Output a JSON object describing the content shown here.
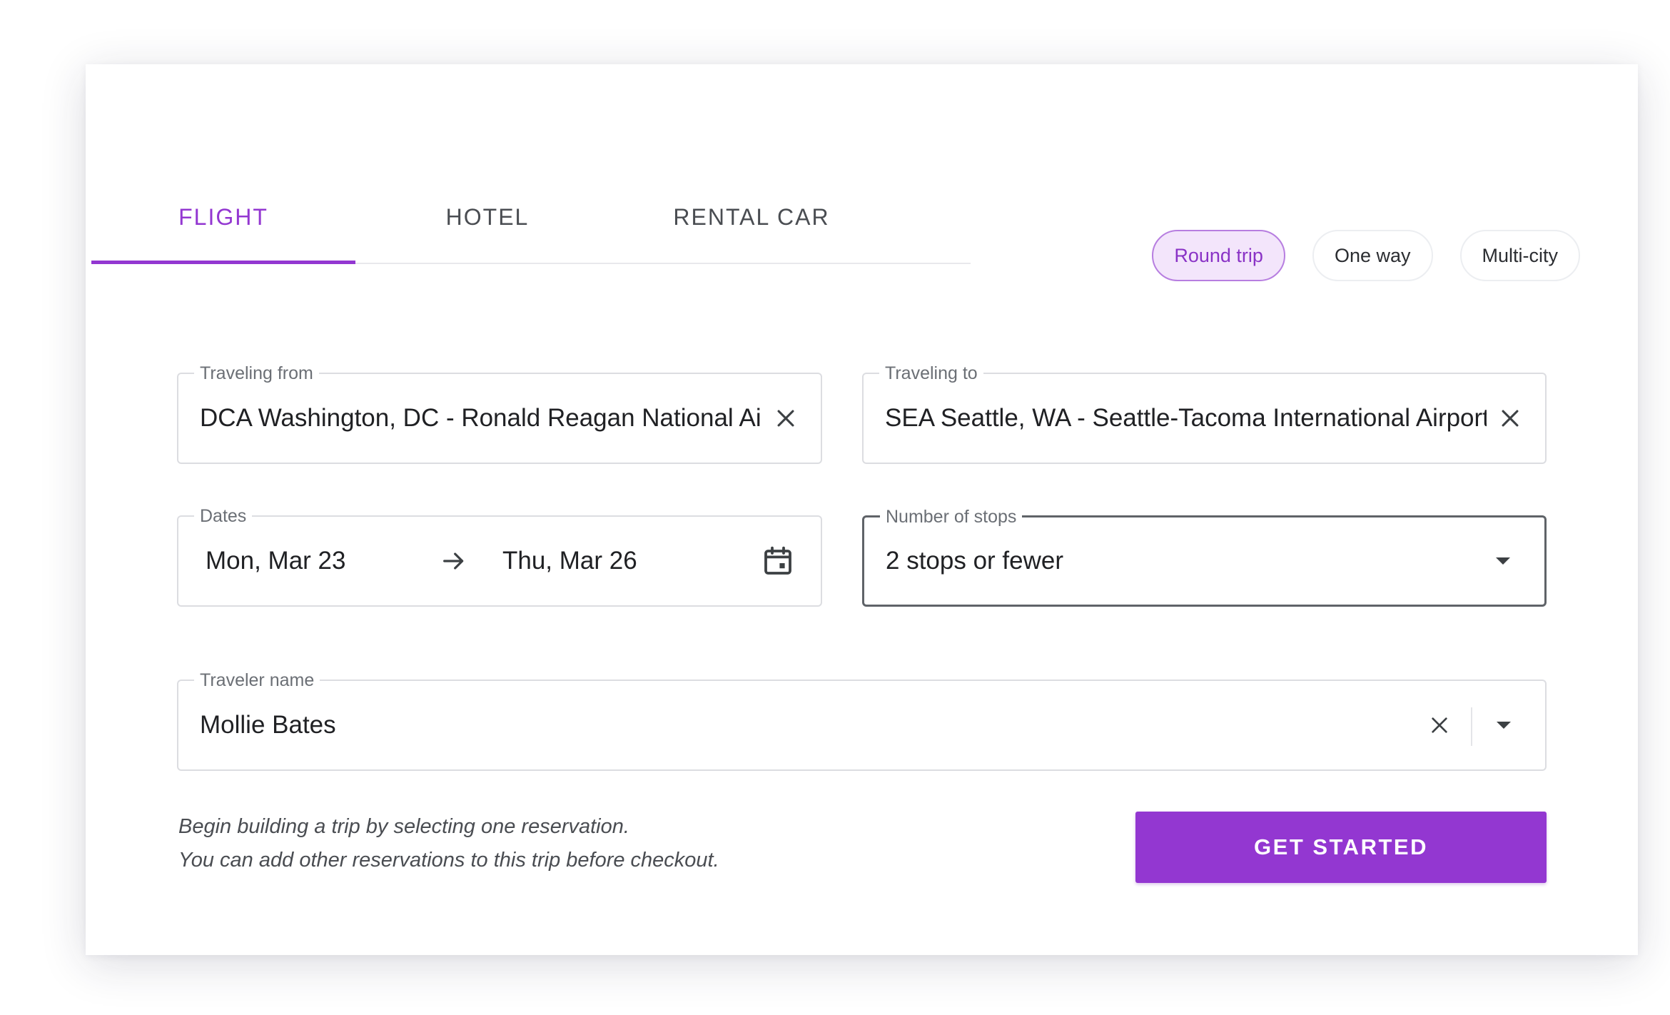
{
  "tabs": [
    {
      "label": "FLIGHT",
      "active": true
    },
    {
      "label": "HOTEL",
      "active": false
    },
    {
      "label": "RENTAL CAR",
      "active": false
    }
  ],
  "trip_types": [
    {
      "label": "Round trip",
      "selected": true
    },
    {
      "label": "One way",
      "selected": false
    },
    {
      "label": "Multi-city",
      "selected": false
    }
  ],
  "fields": {
    "from": {
      "label": "Traveling from",
      "value": "DCA Washington, DC - Ronald Reagan National Airport"
    },
    "to": {
      "label": "Traveling to",
      "value": "SEA Seattle, WA - Seattle-Tacoma International Airport"
    },
    "dates": {
      "label": "Dates",
      "start": "Mon, Mar 23",
      "end": "Thu, Mar 26"
    },
    "stops": {
      "label": "Number of stops",
      "value": "2 stops or fewer"
    },
    "traveler": {
      "label": "Traveler name",
      "value": "Mollie Bates"
    }
  },
  "helper_text": {
    "line1": "Begin building a trip by selecting one reservation.",
    "line2": "You can add other reservations to this trip before checkout."
  },
  "cta_label": "GET STARTED",
  "colors": {
    "accent": "#9337d1",
    "chip_selected_bg": "#f3e5fb",
    "border": "#dcdde1",
    "text": "#202124",
    "muted": "#6b6f75"
  },
  "icons": {
    "clear": "close-icon",
    "calendar": "calendar-icon",
    "arrow": "arrow-right-icon",
    "dropdown": "caret-down-icon"
  }
}
